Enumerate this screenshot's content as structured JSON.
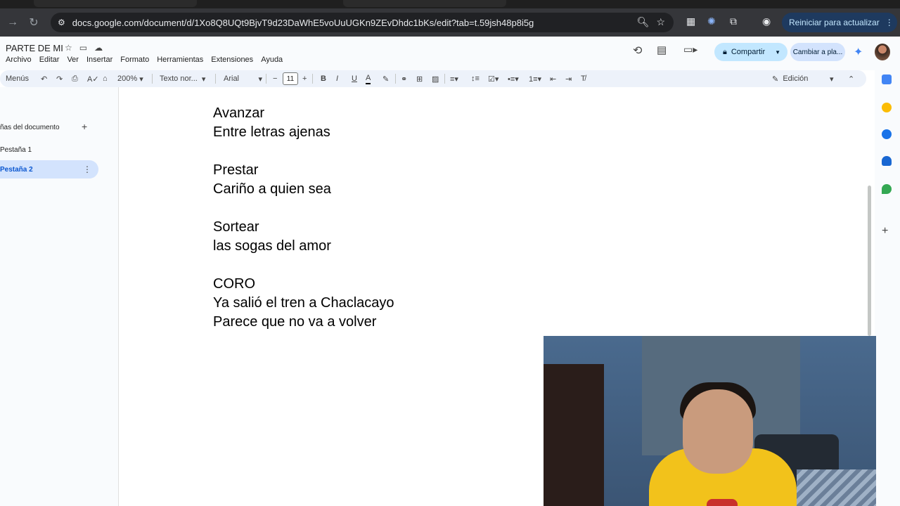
{
  "browser": {
    "url": "docs.google.com/document/d/1Xo8Q8UQt9BjvT9d23DaWhE5voUuUGKn9ZEvDhdc1bKs/edit?tab=t.59jsh48p8i5g",
    "update_button": "Reiniciar para actualizar"
  },
  "doc": {
    "title": "PARTE DE MI",
    "menus": [
      "Archivo",
      "Editar",
      "Ver",
      "Insertar",
      "Formato",
      "Herramientas",
      "Extensiones",
      "Ayuda"
    ],
    "share_label": "Compartir",
    "switch_label": "Cambiar a pla..."
  },
  "toolbar": {
    "menus_label": "Menús",
    "zoom": "200%",
    "style": "Texto nor...",
    "font": "Arial",
    "font_size": "11",
    "mode": "Edición"
  },
  "sidebar": {
    "title": "ñas del documento",
    "tabs": [
      {
        "label": "Pestaña 1"
      },
      {
        "label": "Pestaña 2"
      }
    ]
  },
  "content": {
    "lines": [
      "Avanzar",
      "Entre letras ajenas",
      "",
      "Prestar",
      "Cariño a quien sea",
      "",
      "Sortear",
      "las sogas del amor",
      "",
      "CORO",
      "Ya salió el tren a Chaclacayo",
      "Parece que no va a volver"
    ]
  },
  "colors": {
    "accent": "#0b57d0",
    "share_bg": "#c2e7ff",
    "active_tab_bg": "#d3e3fd"
  }
}
